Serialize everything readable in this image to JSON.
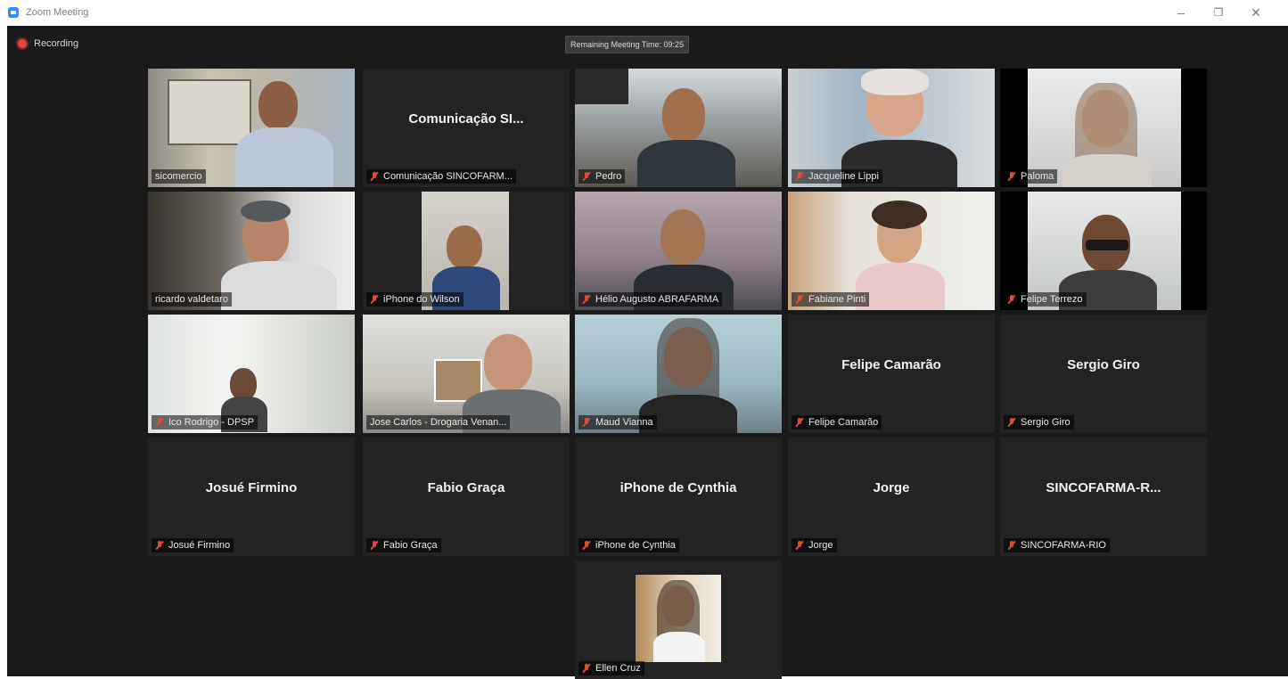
{
  "window": {
    "title": "Zoom Meeting",
    "minimize_icon": "minimize-icon",
    "restore_icon": "restore-icon",
    "close_icon": "close-icon"
  },
  "recording": {
    "label": "Recording",
    "color": "#e8453c"
  },
  "meeting": {
    "remaining_time": "Remaining Meeting Time: 09:25"
  },
  "active_speaker_color": "#a3d843",
  "mic_muted_color": "#e24b3c",
  "participants": [
    {
      "name": "sicomercio",
      "title": "",
      "video": true,
      "muted": false,
      "active": true
    },
    {
      "name": "Comunicação SINCOFARM...",
      "title": "Comunicação  SI...",
      "video": false,
      "muted": true,
      "active": false
    },
    {
      "name": "Pedro",
      "title": "",
      "video": true,
      "muted": true,
      "active": false
    },
    {
      "name": "Jacqueline Lippi",
      "title": "",
      "video": true,
      "muted": true,
      "active": false
    },
    {
      "name": "Paloma",
      "title": "",
      "video": true,
      "muted": true,
      "active": false
    },
    {
      "name": "ricardo valdetaro",
      "title": "",
      "video": true,
      "muted": false,
      "active": false
    },
    {
      "name": "iPhone do Wilson",
      "title": "",
      "video": true,
      "muted": true,
      "active": false
    },
    {
      "name": "Hélio Augusto ABRAFARMA",
      "title": "",
      "video": true,
      "muted": true,
      "active": false
    },
    {
      "name": "Fabiane Pinti",
      "title": "",
      "video": true,
      "muted": true,
      "active": false
    },
    {
      "name": "Felipe Terrezo",
      "title": "",
      "video": true,
      "muted": true,
      "active": false
    },
    {
      "name": "Ico Rodrigo - DPSP",
      "title": "",
      "video": true,
      "muted": true,
      "active": false
    },
    {
      "name": "Jose Carlos - Drogaria Venan...",
      "title": "",
      "video": true,
      "muted": false,
      "active": false
    },
    {
      "name": "Maud Vianna",
      "title": "",
      "video": true,
      "muted": true,
      "active": false
    },
    {
      "name": "Felipe Camarão",
      "title": "Felipe Camarão",
      "video": false,
      "muted": true,
      "active": false
    },
    {
      "name": "Sergio Giro",
      "title": "Sergio Giro",
      "video": false,
      "muted": true,
      "active": false
    },
    {
      "name": "Josué Firmino",
      "title": "Josué Firmino",
      "video": false,
      "muted": true,
      "active": false
    },
    {
      "name": "Fabio Graça",
      "title": "Fabio Graça",
      "video": false,
      "muted": true,
      "active": false
    },
    {
      "name": "iPhone de Cynthia",
      "title": "iPhone de Cynthia",
      "video": false,
      "muted": true,
      "active": false
    },
    {
      "name": "Jorge",
      "title": "Jorge",
      "video": false,
      "muted": true,
      "active": false
    },
    {
      "name": "SINCOFARMA-RIO",
      "title": "SINCOFARMA-R...",
      "video": false,
      "muted": true,
      "active": false
    },
    {
      "name": "Ellen Cruz",
      "title": "",
      "video": true,
      "muted": true,
      "active": false
    }
  ]
}
